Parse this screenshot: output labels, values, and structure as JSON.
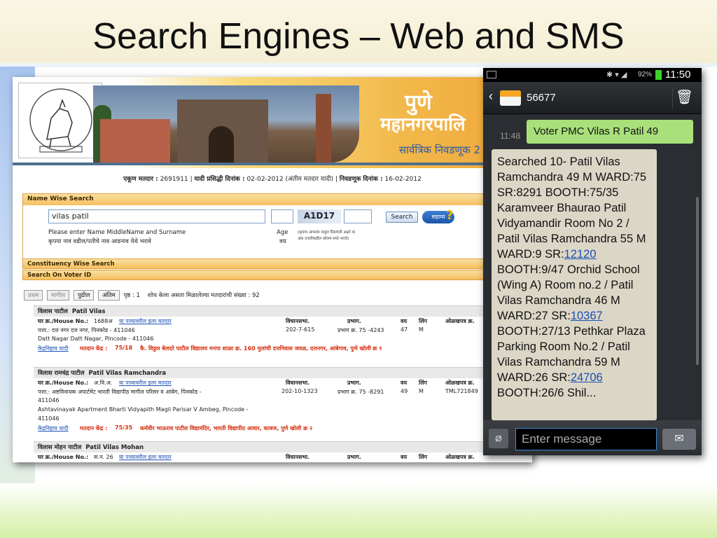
{
  "slide": {
    "title": "Search Engines – Web and SMS"
  },
  "web": {
    "banner": {
      "city_name": "पुणे",
      "corp_name": "महानगरपालि",
      "election_name": "सार्वत्रिक निवडणूक 2",
      "logo_text": "पुणे महानगरपालिका"
    },
    "info": {
      "total_voters_label": "एकूण मतदार :",
      "total_voters": "2691911",
      "publish_date_label": "यादी प्रसिद्धी दिनांक :",
      "publish_date": "02-02-2012",
      "final_list_note": "(अंतीम मतदार यादी)",
      "election_date_label": "निवडणूक दिनांक :",
      "election_date": "16-02-2012"
    },
    "name_search": {
      "header": "Name Wise Search",
      "name_value": "vilas patil",
      "captcha": "A1D17",
      "search_label": "Search",
      "help_label": "सहाय्य",
      "hint_en": "Please enter Name MiddleName and Surname",
      "hint_mr": "कृपया नाव वडील/पतीचे नाव आडनाव येथे भरावे",
      "age_label_en": "Age",
      "age_label_mr": "वय",
      "age_note1": "(कृपया आपल्या माहुल दिसणारी अक्षरे या",
      "age_note2": "अंक उजवीकडील कॉलम मध्ये भरावे)"
    },
    "constituency_search": "Constituency Wise Search",
    "voter_id_search": "Search On Voter ID",
    "pager": {
      "first": "प्रथम",
      "prev": "मागील",
      "next": "पुढील",
      "last": "अंतिम",
      "page_label": "पृष्ठ : 1",
      "result_count_text": "शोध केला असता मिळालेल्या मतदारांची संख्या : 92"
    },
    "results": [
      {
        "header_mr": "विलास पाटील",
        "header_en": "Patil Vilas",
        "house_label": "घर क्र./House No.:",
        "house_no": "1688अ",
        "other_voters_link": "या पत्त्यावरील इतर मतदार",
        "address_mr": "पत्ता.: दत्त नगर दत्त नगर, पिनकोड - 411046",
        "address_en": "Datt Nagar Datt Nagar, Pincode - 411046",
        "constituency": "202-7-615",
        "ward": "प्रभाग क्र. 75 -4243",
        "age": "47",
        "gender": "M",
        "list_link": "केंद्रनिहाय यादी",
        "booth_label": "मतदान केंद्र :",
        "booth": "75/18",
        "booth_address": "कै. विठ्ठल बेलदरे पाटील विद्यालय मनपा शाळा क्र. 160 मुलांची दत्तनिवास जवळ, दत्तनगर, आंबेगाव, पुणे खोली क्र १"
      },
      {
        "header_mr": "विलास रामचंद्र पाटील",
        "header_en": "Patil Vilas Ramchandra",
        "house_label": "घर क्र./House No.:",
        "house_no": "अ.वि.अ.",
        "other_voters_link": "या पत्त्यावरील इतर मतदार",
        "address_mr": "पत्ता.: अष्टविनायक अपार्टमेंट भारती विद्यापीठ मागील परिसर व आंबेग, पिनकोड -",
        "address_mr2": "411046",
        "address_en": "Ashtavinayak Apartment Bharti Vidyapith Magil Parisar V Ambeg, Pincode -",
        "address_en2": "411046",
        "constituency": "202-10-1323",
        "ward": "प्रभाग क्र. 75 -8291",
        "age": "49",
        "gender": "M",
        "id_card": "TML721849",
        "list_link": "केंद्रनिहाय यादी",
        "booth_label": "मतदान केंद्र :",
        "booth": "75/35",
        "booth_address": "कर्मवीर भाऊराव पाटील विद्यामंदिर, भारती विद्यापीठ आवार, कात्रज, पुणे खोली क्र २"
      },
      {
        "header_mr": "विलास मोहन पाटील",
        "header_en": "Patil Vilas Mohan",
        "house_label": "घर क्र./House No.:",
        "house_no": "स.न. 26",
        "other_voters_link": "या पत्त्यावरील इतर मतदार"
      }
    ],
    "columns": {
      "constituency": "विधानसभा.",
      "ward": "प्रभाग.",
      "age": "वय",
      "gender": "लिंग",
      "id_card": "ओळखपत्र क्र."
    }
  },
  "phone": {
    "status": {
      "battery": "92%",
      "time": "11:50"
    },
    "contact": "56677",
    "sent_time": "11:48",
    "sent_message": "Voter PMC Vilas R Patil 49",
    "received_message": {
      "part1": "Searched 10- Patil Vilas Ramchandra 49 M WARD:75 SR:8291 BOOTH:75/35 Karamveer Bhaurao Patil Vidyamandir  Room No 2 / Patil Vilas Ramchandra 55 M WARD:9 SR:",
      "sr1": "12120",
      "part2": " BOOTH:9/47 Orchid School (Wing A) Room no.2 / Patil Vilas Ramchandra 46 M WARD:27 SR:",
      "sr2": "10367",
      "part3": " BOOTH:27/13 Pethkar Plaza Parking Room No.2 / Patil Vilas Ramchandra 59 M WARD:26 SR:",
      "sr3": "24706",
      "part4": " BOOTH:26/6 Shil..."
    },
    "input_placeholder": "Enter message"
  },
  "colors": {
    "sent_bubble": "#a9e07a",
    "received_bubble": "#dcd6c6",
    "panel_header": "#f5c060",
    "link": "#1a4fb8"
  }
}
